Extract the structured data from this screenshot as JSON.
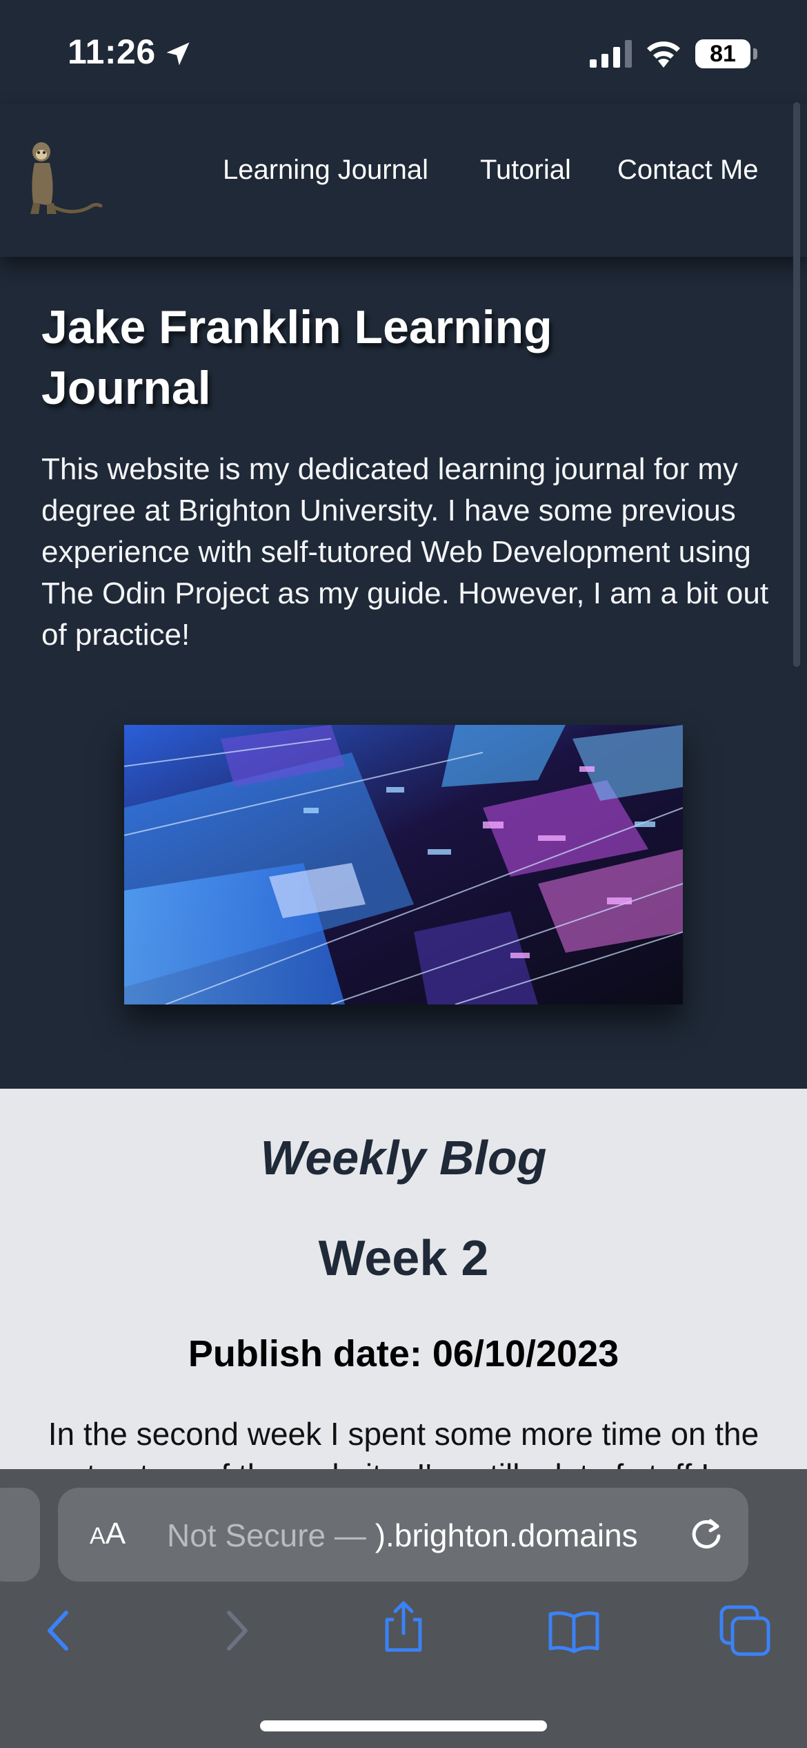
{
  "status_bar": {
    "time": "11:26",
    "battery": "81"
  },
  "nav": {
    "links": [
      "Learning Journal",
      "Tutorial",
      "Contact Me"
    ]
  },
  "hero": {
    "title": "Jake Franklin Learning Journal",
    "intro": "This website is my dedicated learning journal for my degree at Brighton University. I have some previous experience with self-tutored Web Development using The Odin Project as my guide. However, I am a bit out of practice!"
  },
  "blog": {
    "heading": "Weekly Blog",
    "week_title": "Week 2",
    "publish_date": "Publish date: 06/10/2023",
    "body": "In the second week I spent some more time on the structure of the website. I've still a lot of stuff I..."
  },
  "browser": {
    "aa_label_small": "A",
    "aa_label_large": "A",
    "url_prefix": "Not Secure — ",
    "url_domain": ").brighton.domains"
  },
  "colors": {
    "page_dark": "#1f2937",
    "section_light": "#e5e7eb",
    "safari_blue": "#3b82f6",
    "toolbar_gray": "#515458"
  },
  "icons": {
    "status": [
      "location-arrow-icon",
      "cell-signal-icon",
      "wifi-icon",
      "battery-icon"
    ],
    "toolbar": [
      "back-icon",
      "forward-icon",
      "share-icon",
      "bookmarks-icon",
      "tabs-icon"
    ],
    "address": [
      "reload-icon"
    ]
  }
}
